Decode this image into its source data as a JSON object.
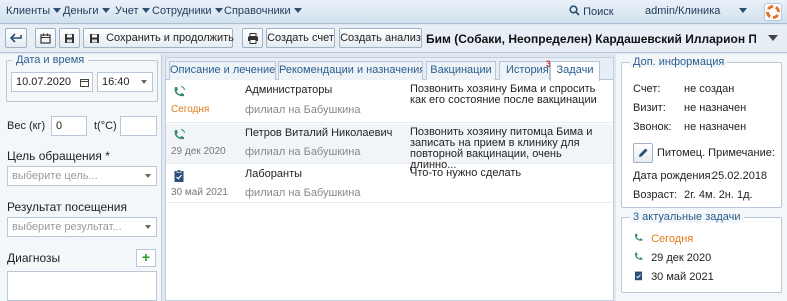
{
  "menu": {
    "items": [
      "Клиенты",
      "Деньги",
      "Учет",
      "Сотрудники",
      "Справочники"
    ],
    "search_label": "Поиск",
    "user_label": "admin/Клиника"
  },
  "toolbar": {
    "save_continue_label": "Сохранить и продолжить",
    "create_invoice_label": "Создать счет",
    "create_analysis_label": "Создать анализ",
    "patient_title": "Бим (Собаки, Неопределен) Кардашевский Илларион Пантел..."
  },
  "left": {
    "datetime_legend": "Дата и время",
    "date_value": "10.07.2020",
    "time_value": "16:40",
    "weight_label": "Вес (кг)",
    "weight_value": "0",
    "temp_label": "t(°C)",
    "temp_value": "",
    "purpose_label": "Цель обращения *",
    "purpose_placeholder": "выберите цель...",
    "result_label": "Результат посещения",
    "result_placeholder": "выберите результат...",
    "diagnoses_label": "Диагнозы",
    "add_symbol": "+"
  },
  "tabs": [
    {
      "label": "Описание и лечение"
    },
    {
      "label": "Рекомендации и назначения"
    },
    {
      "label": "Вакцинации"
    },
    {
      "label": "История"
    },
    {
      "label": "Задачи"
    }
  ],
  "tasks_badge": "3",
  "tasks": [
    {
      "icon": "phone-icon",
      "date": "Сегодня",
      "who": "Администраторы",
      "branch": "филиал на Бабушкина",
      "text": "Позвонить хозяину Бима и спросить как его состояние после вакцинации"
    },
    {
      "icon": "phone-icon",
      "date": "29 дек 2020",
      "who": "Петров Виталий Николаевич",
      "branch": "филиал на Бабушкина",
      "text": "Позвонить хозяину питомца Бима и записать на прием в клинику для повторной вакцинации, очень длинно..."
    },
    {
      "icon": "clipboard-icon",
      "date": "30 май 2021",
      "who": "Лаборанты",
      "branch": "филиал на Бабушкина",
      "text": "Что-то нужно сделать"
    }
  ],
  "info": {
    "legend": "Доп. информация",
    "invoice_label": "Счет:",
    "invoice_value": "не создан",
    "visit_label": "Визит:",
    "visit_value": "не назначен",
    "call_label": "Звонок:",
    "call_value": "не назначен",
    "pet_note_label": "Питомец. Примечание:",
    "birth_label": "Дата рождения:",
    "birth_value": "25.02.2018",
    "age_label": "Возраст:",
    "age_value": "2г. 4м. 2н. 1д."
  },
  "active_tasks": {
    "legend": "3 актуальные задачи",
    "items": [
      {
        "icon": "phone-icon",
        "label": "Сегодня"
      },
      {
        "icon": "phone-icon",
        "label": "29 дек 2020"
      },
      {
        "icon": "clipboard-icon",
        "label": "30 май 2021"
      }
    ]
  },
  "colors": {
    "accent": "#2a5d8f",
    "today": "#e07b17",
    "badge": "#d02a2a"
  }
}
